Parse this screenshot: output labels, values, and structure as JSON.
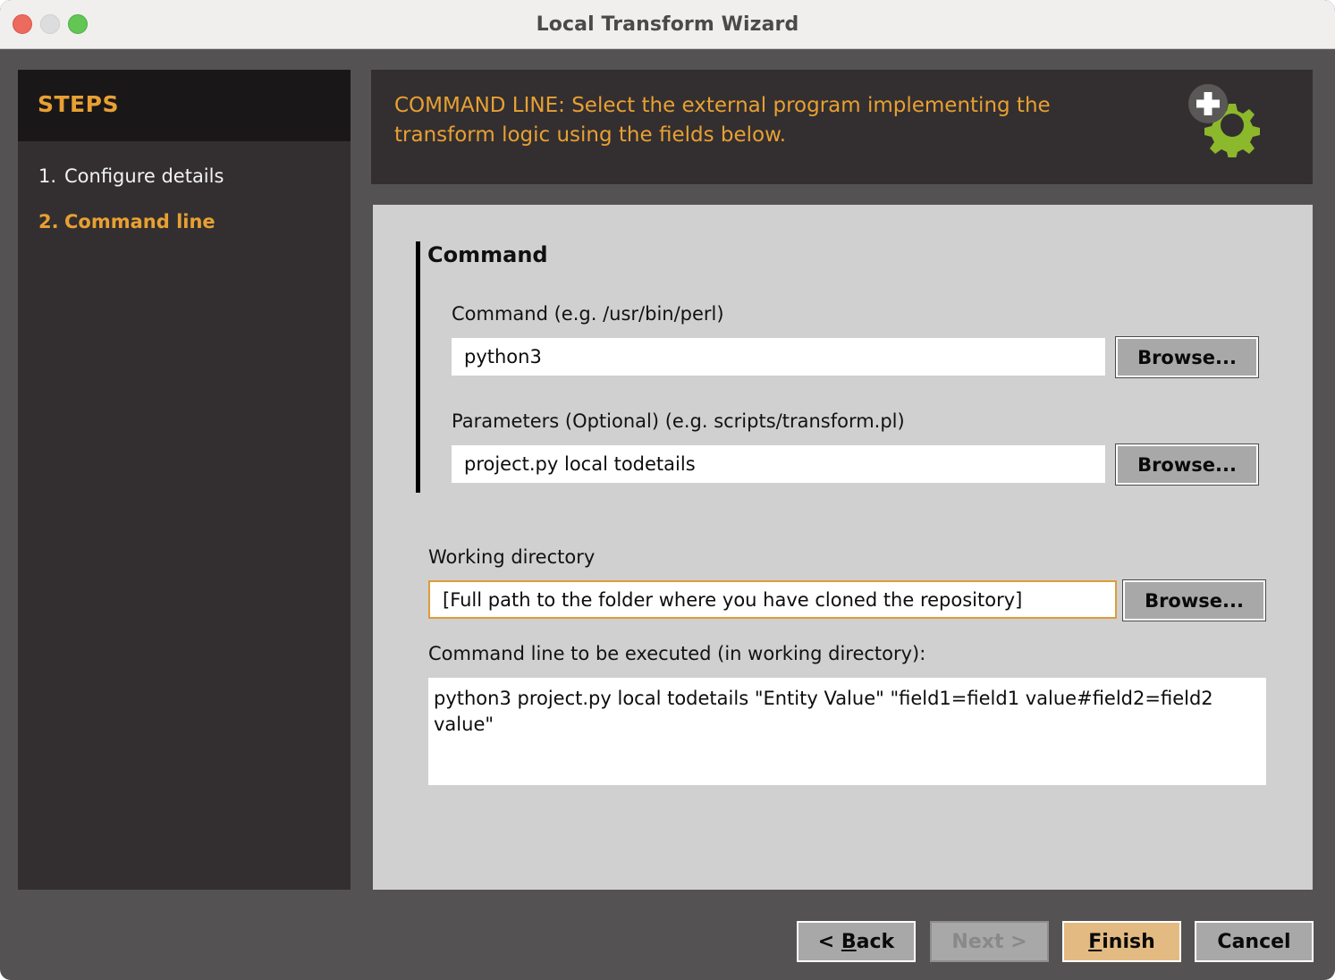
{
  "window": {
    "title": "Local Transform Wizard",
    "controls": {
      "close": "close-button",
      "minimize": "minimize-button",
      "zoom": "zoom-button"
    }
  },
  "sidebar": {
    "header": "STEPS",
    "steps": [
      {
        "num": "1.",
        "label": "Configure details",
        "active": false
      },
      {
        "num": "2.",
        "label": "Command line",
        "active": true
      }
    ]
  },
  "banner": {
    "text": "COMMAND LINE: Select the external program implementing the transform logic using the fields below.",
    "icon": "add-gear-icon"
  },
  "panel": {
    "group": {
      "title": "Command",
      "fields": [
        {
          "label": "Command (e.g. /usr/bin/perl)",
          "value": "python3",
          "placeholder": "",
          "browse_label": "Browse..."
        },
        {
          "label": "Parameters (Optional) (e.g. scripts/transform.pl)",
          "value": "project.py local todetails",
          "placeholder": "",
          "browse_label": "Browse..."
        }
      ]
    },
    "working_directory": {
      "label": "Working directory",
      "value": "[Full path to the folder where you have cloned the repository]",
      "placeholder": "",
      "browse_label": "Browse..."
    },
    "preview": {
      "label": "Command line to be executed (in working directory):",
      "value": "python3 project.py local todetails \"Entity Value\" \"field1=field1 value#field2=field2 value\""
    }
  },
  "footer": {
    "back": {
      "prefix": "< ",
      "mnemonic": "B",
      "rest": "ack"
    },
    "next": {
      "prefix": "",
      "text": "Next >"
    },
    "finish": {
      "mnemonic": "F",
      "rest": "inish"
    },
    "cancel": {
      "text": "Cancel"
    }
  },
  "colors": {
    "accent_orange": "#e8a033",
    "gear_green": "#8cb82b",
    "panel_bg": "#d0d0d0",
    "window_bg": "#555253",
    "sidebar_bg": "#332f30",
    "sidebar_header_bg": "#1a1718",
    "focus_border": "#dd9c38",
    "finish_bg": "#e3bb82"
  }
}
